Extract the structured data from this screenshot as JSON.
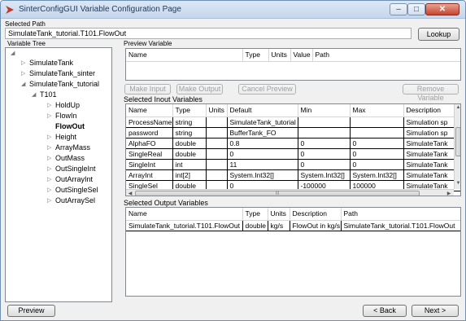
{
  "window": {
    "title": "SinterConfigGUI Variable Configuration Page"
  },
  "controls": {
    "minimize": "–",
    "maximize": "□",
    "close": "✕"
  },
  "selected_path": {
    "label": "Selected Path",
    "value": "SimulateTank_tutorial.T101.FlowOut",
    "lookup_label": "Lookup"
  },
  "variable_tree": {
    "label": "Variable Tree",
    "root_glyph": "◢",
    "items": [
      {
        "label": "SimulateTank"
      },
      {
        "label": "SimulateTank_sinter"
      },
      {
        "label": "SimulateTank_tutorial"
      },
      {
        "label": "T101"
      },
      {
        "label": "HoldUp"
      },
      {
        "label": "FlowIn"
      },
      {
        "label": "FlowOut"
      },
      {
        "label": "Height"
      },
      {
        "label": "ArrayMass"
      },
      {
        "label": "OutMass"
      },
      {
        "label": "OutSingleInt"
      },
      {
        "label": "OutArrayInt"
      },
      {
        "label": "OutSingleSel"
      },
      {
        "label": "OutArraySel"
      }
    ]
  },
  "preview_variable": {
    "label": "Preview Variable",
    "columns": [
      "Name",
      "Type",
      "Units",
      "Value",
      "Path"
    ]
  },
  "actions": {
    "make_input": "Make Input",
    "make_output": "Make Output",
    "cancel_preview": "Cancel Preview",
    "remove_variable": "Remove Variable"
  },
  "inputs": {
    "label": "Selected Inout Variables",
    "columns": [
      "Name",
      "Type",
      "Units",
      "Default",
      "Min",
      "Max",
      "Description"
    ],
    "rows": [
      [
        "ProcessName",
        "string",
        "",
        "SimulateTank_tutorial",
        "",
        "",
        "Simulation sp"
      ],
      [
        "password",
        "string",
        "",
        "BufferTank_FO",
        "",
        "",
        "Simulation sp"
      ],
      [
        "AlphaFO",
        "double",
        "",
        "0.8",
        "0",
        "0",
        "SimulateTank"
      ],
      [
        "SingleReal",
        "double",
        "",
        "0",
        "0",
        "0",
        "SimulateTank"
      ],
      [
        "SingleInt",
        "int",
        "",
        "11",
        "0",
        "0",
        "SimulateTank"
      ],
      [
        "ArrayInt",
        "int[2]",
        "",
        "System.Int32[]",
        "System.Int32[]",
        "System.Int32[]",
        "SimulateTank"
      ],
      [
        "SingleSel",
        "double",
        "",
        "0",
        "-100000",
        "100000",
        "SimulateTank"
      ]
    ]
  },
  "outputs": {
    "label": "Selected Output Variables",
    "columns": [
      "Name",
      "Type",
      "Units",
      "Description",
      "Path"
    ],
    "rows": [
      [
        "SimulateTank_tutorial.T101.FlowOut",
        "double",
        "kg/s",
        "FlowOut in kg/s",
        "SimulateTank_tutorial.T101.FlowOut"
      ]
    ]
  },
  "footer": {
    "preview": "Preview",
    "back": "< Back",
    "next": "Next >"
  },
  "scroll_glyphs": {
    "up": "▲",
    "down": "▼",
    "left": "◀",
    "right": "▶",
    "grip": "|||"
  }
}
